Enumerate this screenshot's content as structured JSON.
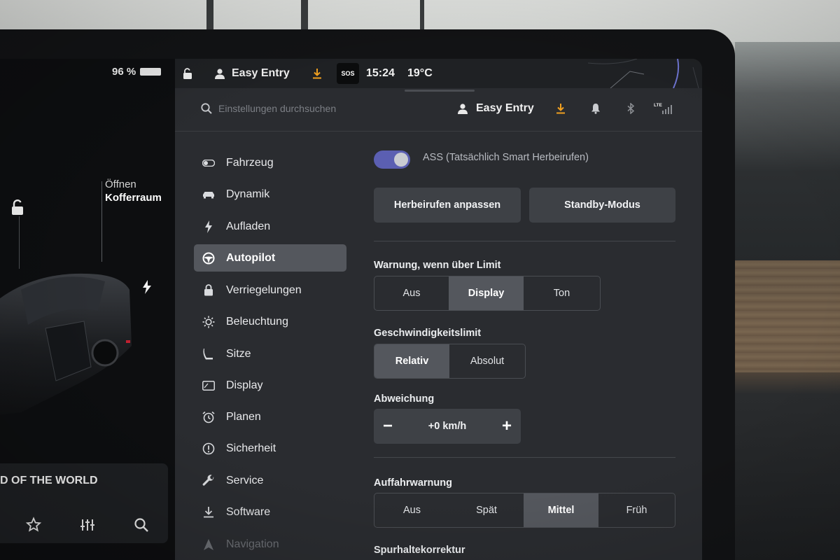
{
  "status_bar": {
    "battery": "96 %",
    "profile": "Easy Entry",
    "sos": "SOS",
    "time": "15:24",
    "temperature": "19°C"
  },
  "car_view": {
    "trunk_action": "Öffnen",
    "trunk_name": "Kofferraum",
    "media_title": "D OF THE WORLD"
  },
  "header": {
    "search_placeholder": "Einstellungen durchsuchen",
    "profile": "Easy Entry",
    "lte": "LTE"
  },
  "sidebar": {
    "items": [
      {
        "label": "Fahrzeug",
        "icon": "toggle-icon"
      },
      {
        "label": "Dynamik",
        "icon": "car-icon"
      },
      {
        "label": "Aufladen",
        "icon": "bolt-icon"
      },
      {
        "label": "Autopilot",
        "icon": "steering-wheel-icon",
        "active": true
      },
      {
        "label": "Verriegelungen",
        "icon": "lock-icon"
      },
      {
        "label": "Beleuchtung",
        "icon": "sun-icon"
      },
      {
        "label": "Sitze",
        "icon": "seat-icon"
      },
      {
        "label": "Display",
        "icon": "display-icon"
      },
      {
        "label": "Planen",
        "icon": "alarm-clock-icon"
      },
      {
        "label": "Sicherheit",
        "icon": "alert-circle-icon"
      },
      {
        "label": "Service",
        "icon": "wrench-icon"
      },
      {
        "label": "Software",
        "icon": "download-icon"
      },
      {
        "label": "Navigation",
        "icon": "navigation-icon"
      }
    ]
  },
  "content": {
    "ass_label": "ASS (Tatsächlich Smart Herbeirufen)",
    "ass_enabled": true,
    "btn_customize": "Herbeirufen anpassen",
    "btn_standby": "Standby-Modus",
    "warning": {
      "label": "Warnung, wenn über Limit",
      "options": [
        "Aus",
        "Display",
        "Ton"
      ],
      "selected": "Display"
    },
    "speed_limit": {
      "label": "Geschwindigkeitslimit",
      "options": [
        "Relativ",
        "Absolut"
      ],
      "selected": "Relativ"
    },
    "offset": {
      "label": "Abweichung",
      "value": "+0 km/h",
      "minus": "−",
      "plus": "+"
    },
    "collision": {
      "label": "Auffahrwarnung",
      "options": [
        "Aus",
        "Spät",
        "Mittel",
        "Früh"
      ],
      "selected": "Mittel"
    },
    "cutoff_label": "Spurhaltekorrektur"
  },
  "colors": {
    "accent_orange": "#f0a020",
    "toggle_purple": "#5b5fb2",
    "panel_bg": "#2a2c30",
    "selected_bg": "#54575d"
  }
}
